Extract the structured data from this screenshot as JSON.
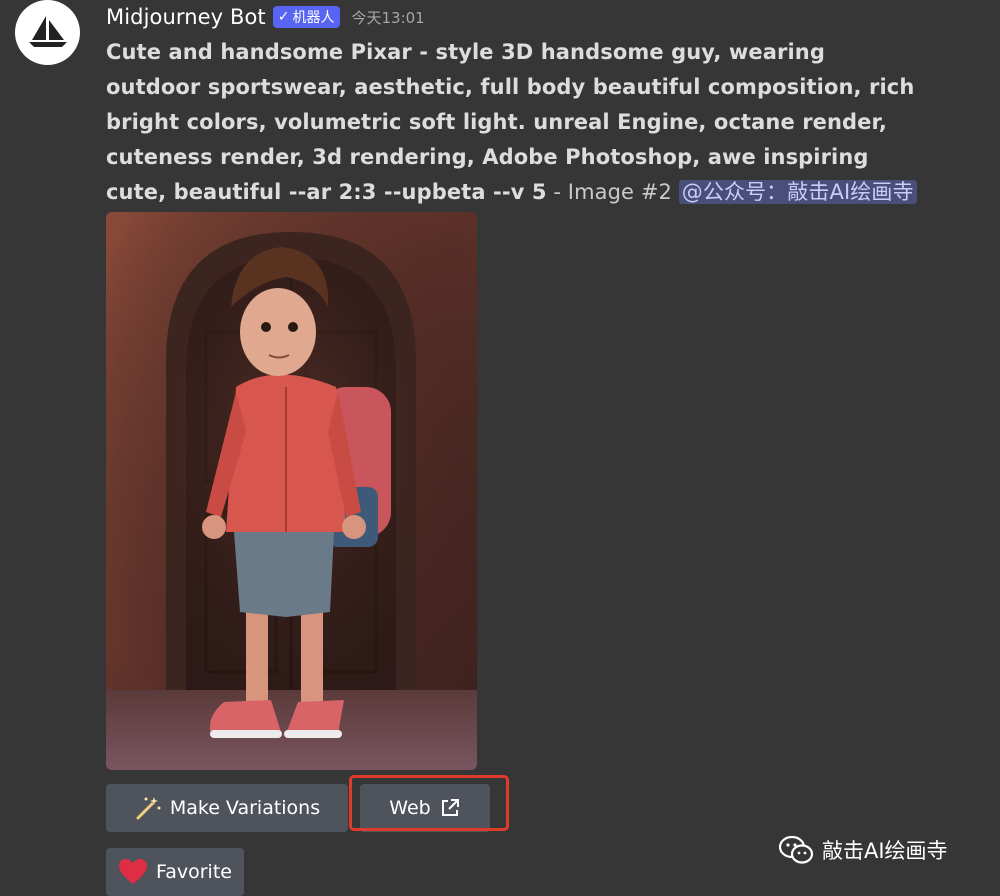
{
  "author": {
    "name": "Midjourney Bot",
    "badge_check": "✓",
    "badge_label": "机器人",
    "timestamp": "今天13:01"
  },
  "message": {
    "prompt_text": "Cute and handsome Pixar - style 3D handsome guy, wearing outdoor sportswear, aesthetic, full body beautiful composition, rich bright colors, volumetric soft light. unreal Engine, octane render, cuteness render, 3d rendering, Adobe Photoshop, awe inspiring cute, beautiful --ar 2:3 --upbeta --v 5",
    "suffix": " - Image #2 ",
    "mention": "@公众号：敲击AI绘画寺"
  },
  "buttons": {
    "variations": "Make Variations",
    "web": "Web",
    "favorite": "Favorite"
  },
  "watermark": {
    "text": "敲击AI绘画寺"
  },
  "colors": {
    "background": "#363636",
    "button": "#4f545c",
    "badge": "#5865f2",
    "highlight": "#e03a2b"
  }
}
